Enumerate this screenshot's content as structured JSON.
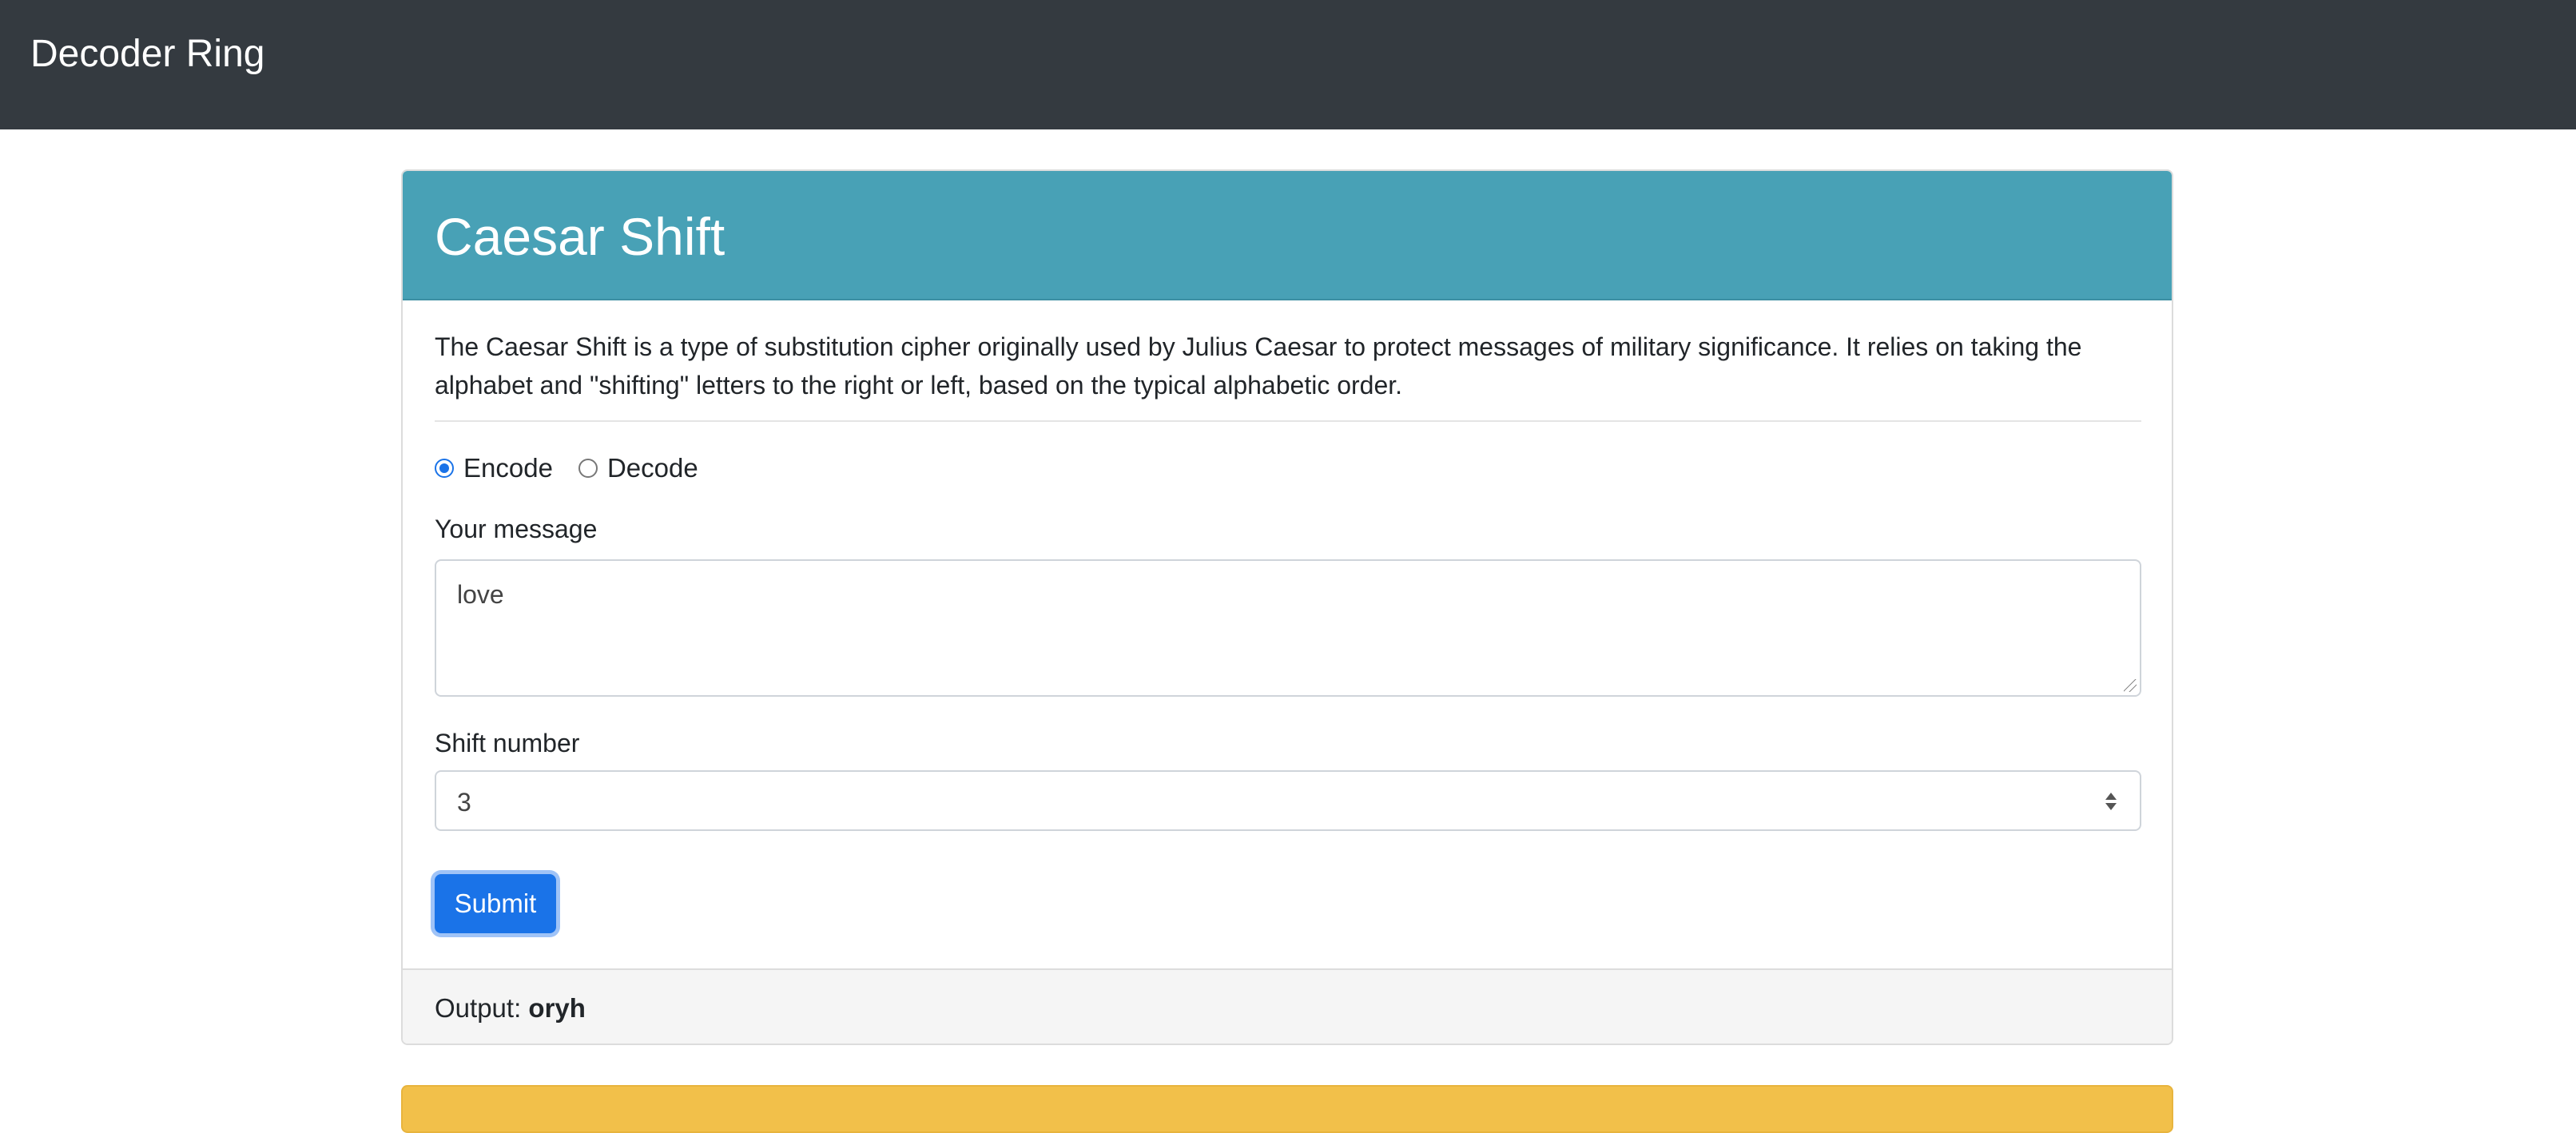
{
  "navbar": {
    "brand": "Decoder Ring"
  },
  "caesar": {
    "title": "Caesar Shift",
    "description": "The Caesar Shift is a type of substitution cipher originally used by Julius Caesar to protect messages of military significance. It relies on taking the alphabet and \"shifting\" letters to the right or left, based on the typical alphabetic order.",
    "mode": {
      "options": [
        {
          "label": "Encode",
          "checked": true
        },
        {
          "label": "Decode",
          "checked": false
        }
      ]
    },
    "message": {
      "label": "Your message",
      "value": "love"
    },
    "shift": {
      "label": "Shift number",
      "value": "3"
    },
    "submit_label": "Submit",
    "output": {
      "label": "Output:",
      "value": "oryh"
    }
  },
  "colors": {
    "navbar": "#343a40",
    "card_header": "#48a1b6",
    "button": "#1a73e8",
    "next_card_header": "#f2c04a"
  }
}
